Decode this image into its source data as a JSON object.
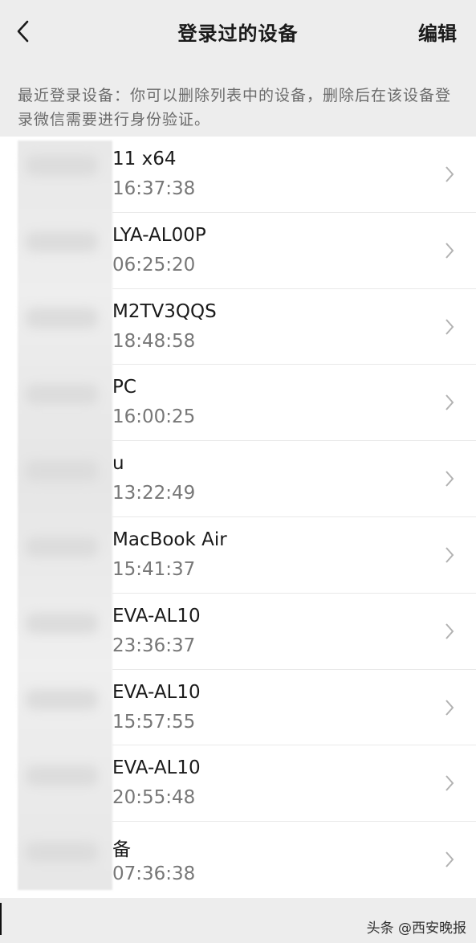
{
  "header": {
    "title": "登录过的设备",
    "edit_label": "编辑"
  },
  "description": "最近登录设备：你可以删除列表中的设备，删除后在该设备登录微信需要进行身份验证。",
  "devices": [
    {
      "name": "11 x64",
      "time": "16:37:38"
    },
    {
      "name": "LYA-AL00P",
      "time": "06:25:20"
    },
    {
      "name": "M2TV3QQS",
      "time": "18:48:58"
    },
    {
      "name": "PC",
      "time": "16:00:25"
    },
    {
      "name": "u",
      "time": "13:22:49"
    },
    {
      "name": "MacBook Air",
      "time": "15:41:37"
    },
    {
      "name": "EVA-AL10",
      "time": "23:36:37"
    },
    {
      "name": "EVA-AL10",
      "time": "15:57:55"
    },
    {
      "name": "EVA-AL10",
      "time": "20:55:48"
    },
    {
      "name": "备",
      "time": "07:36:38"
    }
  ],
  "watermark": "头条 @西安晚报",
  "icons": {
    "back": "chevron-left-icon",
    "row": "chevron-right-icon"
  },
  "colors": {
    "background": "#ededed",
    "list_background": "#ffffff",
    "secondary_text": "#777777"
  }
}
